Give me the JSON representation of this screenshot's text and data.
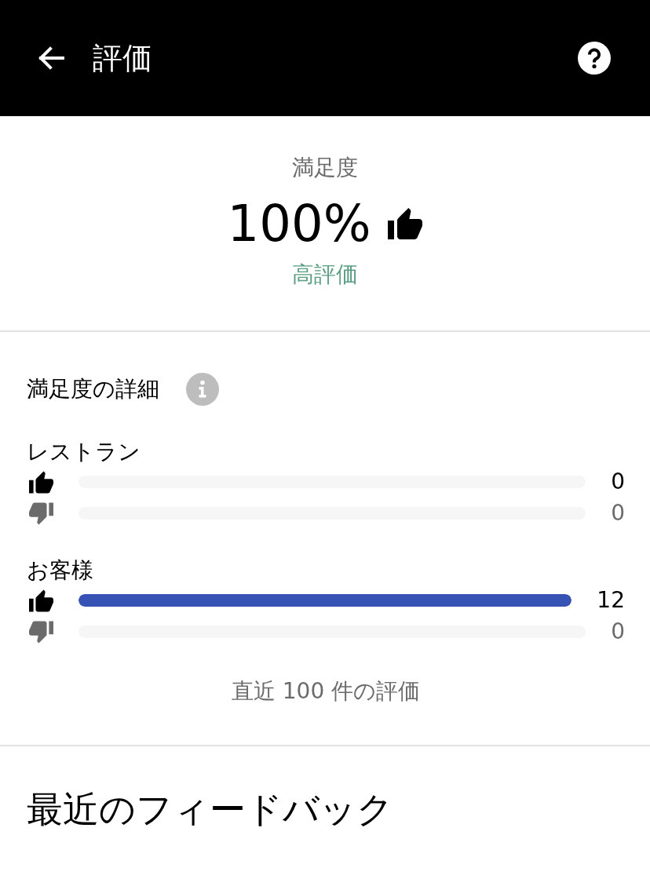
{
  "header": {
    "title": "評価"
  },
  "summary": {
    "label": "満足度",
    "value": "100%",
    "rating": "高評価"
  },
  "details": {
    "title": "満足度の詳細",
    "groups": [
      {
        "name": "レストラン",
        "rows": [
          {
            "kind": "up",
            "level": 0,
            "count": "0"
          },
          {
            "kind": "down",
            "level": 0,
            "count": "0"
          }
        ]
      },
      {
        "name": "お客様",
        "rows": [
          {
            "kind": "up",
            "level": 1,
            "count": "12"
          },
          {
            "kind": "down",
            "level": 0,
            "count": "0"
          }
        ]
      }
    ],
    "footnote": "直近 100 件の評価"
  },
  "feedback": {
    "title": "最近のフィードバック"
  }
}
